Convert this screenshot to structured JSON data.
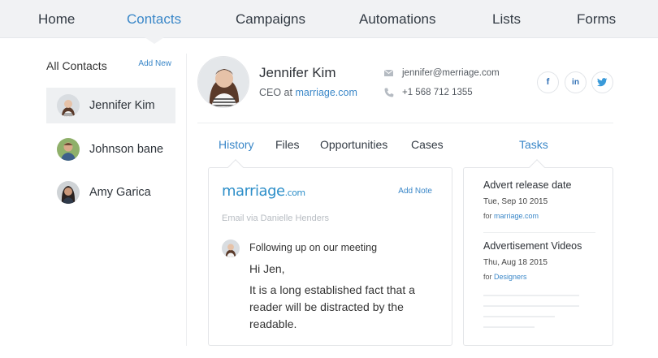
{
  "nav": {
    "tabs": [
      "Home",
      "Contacts",
      "Campaigns",
      "Automations",
      "Lists",
      "Forms"
    ],
    "active": "Contacts"
  },
  "sidebar": {
    "title": "All Contacts",
    "add_new": "Add New",
    "contacts": [
      "Jennifer Kim",
      "Johnson bane",
      "Amy Garica"
    ]
  },
  "profile": {
    "name": "Jennifer Kim",
    "role_prefix": "CEO at",
    "company": "marriage.com",
    "email": "jennifer@merriage.com",
    "phone": "+1 568 712 1355",
    "social": [
      "f",
      "in",
      "t"
    ]
  },
  "subtabs": {
    "items": [
      "History",
      "Files",
      "Opportunities",
      "Cases"
    ],
    "active": "History",
    "tasks_label": "Tasks"
  },
  "history": {
    "logo_main": "marriage",
    "logo_suffix": ".com",
    "add_note": "Add Note",
    "via": "Email via Danielle Henders",
    "subject": "Following up on our meeting",
    "greeting": "Hi Jen,",
    "body": "It is a long established fact that a reader will be distracted by the readable."
  },
  "tasks": [
    {
      "title": "Advert release date",
      "date": "Tue, Sep 10 2015",
      "for_prefix": "for",
      "for_link": "marriage.com"
    },
    {
      "title": "Advertisement Videos",
      "date": "Thu, Aug 18 2015",
      "for_prefix": "for",
      "for_link": "Designers"
    }
  ],
  "colors": {
    "accent": "#3a87c8",
    "nav_bg": "#f1f2f4",
    "active_row": "#eef0f2"
  }
}
